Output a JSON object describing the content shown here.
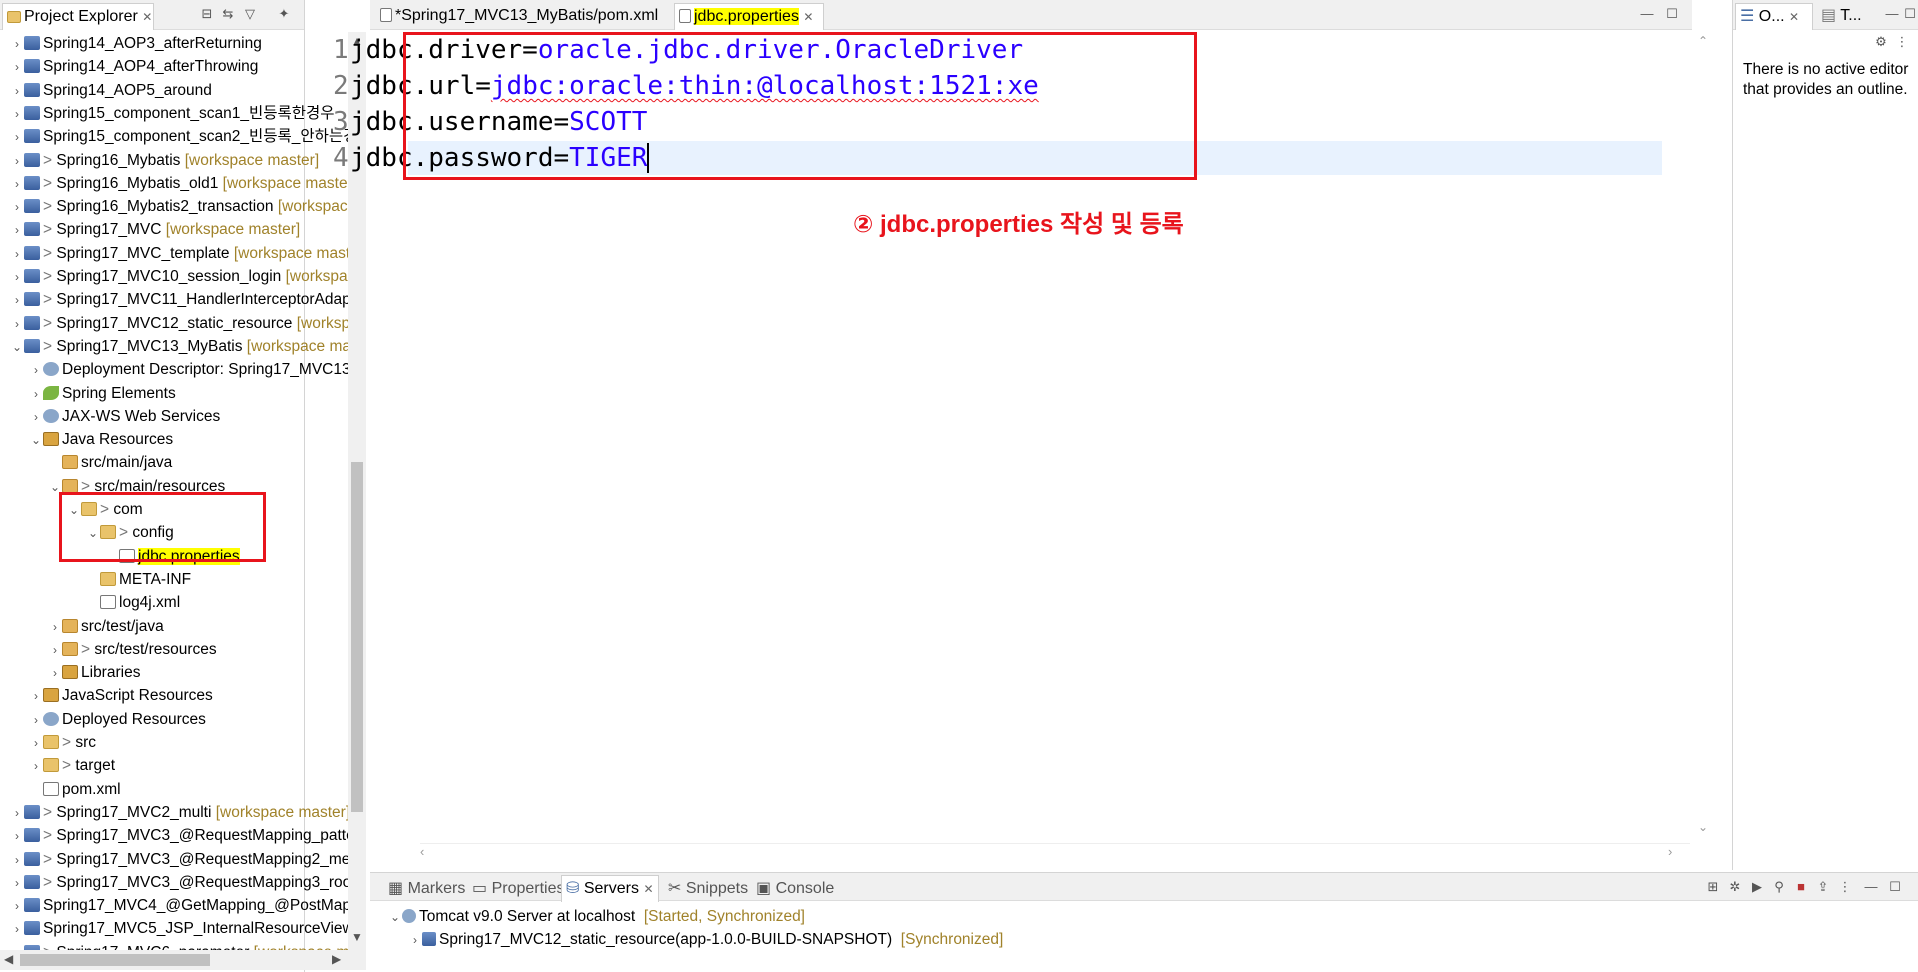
{
  "project_explorer": {
    "title": "Project Explorer",
    "rows": [
      {
        "prefix": "",
        "label": "Spring14_AOP3_afterReturning",
        "deco": ""
      },
      {
        "prefix": "",
        "label": "Spring14_AOP4_afterThrowing",
        "deco": ""
      },
      {
        "prefix": "",
        "label": "Spring14_AOP5_around",
        "deco": ""
      },
      {
        "prefix": "",
        "label": "Spring15_component_scan1_빈등록한경우",
        "deco": ""
      },
      {
        "prefix": "",
        "label": "Spring15_component_scan2_빈등록_안하는경",
        "deco": ""
      },
      {
        "prefix": "> ",
        "label": "Spring16_Mybatis",
        "deco": "[workspace master]"
      },
      {
        "prefix": "> ",
        "label": "Spring16_Mybatis_old1",
        "deco": "[workspace master"
      },
      {
        "prefix": "> ",
        "label": "Spring16_Mybatis2_transaction",
        "deco": "[workspace"
      },
      {
        "prefix": "> ",
        "label": "Spring17_MVC",
        "deco": "[workspace master]"
      },
      {
        "prefix": "> ",
        "label": "Spring17_MVC_template",
        "deco": "[workspace maste"
      },
      {
        "prefix": "> ",
        "label": "Spring17_MVC10_session_login",
        "deco": "[workspace"
      },
      {
        "prefix": "> ",
        "label": "Spring17_MVC11_HandlerInterceptorAdap",
        "deco": ""
      },
      {
        "prefix": "> ",
        "label": "Spring17_MVC12_static_resource",
        "deco": "[workspa"
      },
      {
        "prefix": "> ",
        "label": "Spring17_MVC13_MyBatis",
        "deco": "[workspace mas"
      },
      {
        "prefix": "",
        "label": "Deployment Descriptor: Spring17_MVC13_",
        "deco": ""
      },
      {
        "prefix": "",
        "label": "Spring Elements",
        "deco": ""
      },
      {
        "prefix": "",
        "label": "JAX-WS Web Services",
        "deco": ""
      },
      {
        "prefix": "",
        "label": "Java Resources",
        "deco": ""
      },
      {
        "prefix": "",
        "label": "src/main/java",
        "deco": ""
      },
      {
        "prefix": "> ",
        "label": "src/main/resources",
        "deco": ""
      },
      {
        "prefix": "> ",
        "label": "com",
        "deco": ""
      },
      {
        "prefix": "> ",
        "label": "config",
        "deco": ""
      },
      {
        "prefix": "",
        "label": "jdbc.properties",
        "deco": ""
      },
      {
        "prefix": "",
        "label": "META-INF",
        "deco": ""
      },
      {
        "prefix": "",
        "label": "log4j.xml",
        "deco": ""
      },
      {
        "prefix": "",
        "label": "src/test/java",
        "deco": ""
      },
      {
        "prefix": "> ",
        "label": "src/test/resources",
        "deco": ""
      },
      {
        "prefix": "",
        "label": "Libraries",
        "deco": ""
      },
      {
        "prefix": "",
        "label": "JavaScript Resources",
        "deco": ""
      },
      {
        "prefix": "",
        "label": "Deployed Resources",
        "deco": ""
      },
      {
        "prefix": "> ",
        "label": "src",
        "deco": ""
      },
      {
        "prefix": "> ",
        "label": "target",
        "deco": ""
      },
      {
        "prefix": "",
        "label": "pom.xml",
        "deco": ""
      },
      {
        "prefix": "> ",
        "label": "Spring17_MVC2_multi",
        "deco": "[workspace master]"
      },
      {
        "prefix": "> ",
        "label": "Spring17_MVC3_@RequestMapping_patte",
        "deco": ""
      },
      {
        "prefix": "> ",
        "label": "Spring17_MVC3_@RequestMapping2_meth",
        "deco": ""
      },
      {
        "prefix": "> ",
        "label": "Spring17_MVC3_@RequestMapping3_root",
        "deco": ""
      },
      {
        "prefix": "",
        "label": "Spring17_MVC4_@GetMapping_@PostMapp",
        "deco": ""
      },
      {
        "prefix": "",
        "label": "Spring17_MVC5_JSP_InternalResourceViewRe",
        "deco": ""
      },
      {
        "prefix": "> ",
        "label": "Spring17_MVC6_parameter",
        "deco": "[workspace maste"
      }
    ]
  },
  "editor": {
    "tabs": [
      {
        "label": "*Spring17_MVC13_MyBatis/pom.xml"
      },
      {
        "label": "jdbc.properties"
      }
    ],
    "lines": [
      {
        "num": "1",
        "key": "jdbc.driver=",
        "value": "oracle.jdbc.driver.OracleDriver"
      },
      {
        "num": "2",
        "key": "jdbc.url=",
        "value": "jdbc:oracle:thin:@localhost:1521:xe"
      },
      {
        "num": "3",
        "key": "jdbc.username=",
        "value": "SCOTT"
      },
      {
        "num": "4",
        "key": "jdbc.password=",
        "value": "TIGER"
      }
    ],
    "annotation": "② jdbc.properties 작성 및 등록"
  },
  "outline": {
    "tab1": "O...",
    "tab2": "T...",
    "message": "There is no active editor that provides an outline."
  },
  "bottom": {
    "tabs": [
      {
        "label": "Markers"
      },
      {
        "label": "Properties"
      },
      {
        "label": "Servers"
      },
      {
        "label": "Snippets"
      },
      {
        "label": "Console"
      }
    ],
    "server": {
      "name": "Tomcat v9.0 Server at localhost",
      "state": "[Started, Synchronized]"
    },
    "module": {
      "name": "Spring17_MVC12_static_resource(app-1.0.0-BUILD-SNAPSHOT)",
      "state": "[Synchronized]"
    }
  },
  "colors": {
    "annotation_red": "#e8141c",
    "highlight_yellow": "#ffff00",
    "value_blue": "#2a00ff",
    "decoration_brown": "#a0822a"
  }
}
